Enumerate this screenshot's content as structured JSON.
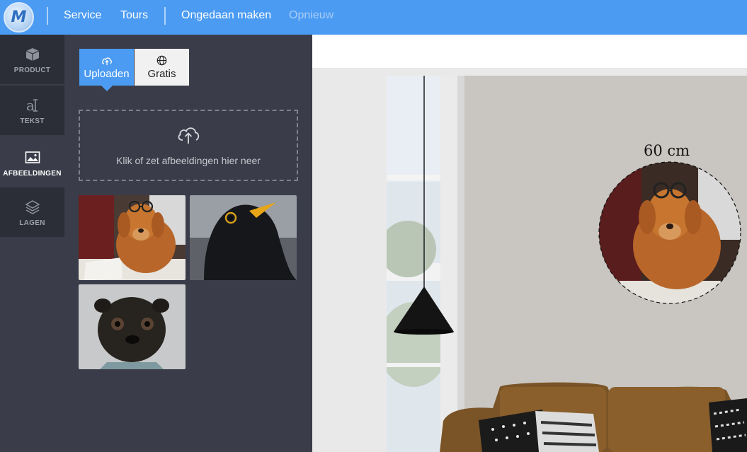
{
  "topbar": {
    "logo_letter": "M",
    "service": "Service",
    "tours": "Tours",
    "undo": "Ongedaan maken",
    "redo": "Opnieuw"
  },
  "rail": {
    "items": [
      {
        "label": "PRODUCT",
        "icon": "box-icon"
      },
      {
        "label": "TEKST",
        "icon": "text-icon"
      },
      {
        "label": "AFBEELDINGEN",
        "icon": "image-icon",
        "active": true
      },
      {
        "label": "LAGEN",
        "icon": "layers-icon"
      }
    ]
  },
  "panel": {
    "tabs": [
      {
        "label": "Uploaden",
        "icon": "cloud-upload-icon",
        "active": true
      },
      {
        "label": "Gratis",
        "icon": "globe-icon"
      }
    ],
    "dropzone_text": "Klik of zet afbeeldingen hier neer",
    "thumbnails": [
      "dog with glasses",
      "blackbird",
      "pug"
    ]
  },
  "canvas": {
    "dimension_label": "60 cm"
  },
  "colors": {
    "accent": "#4b9bf2",
    "panel": "#3a3d49",
    "rail": "#2b2e36"
  }
}
